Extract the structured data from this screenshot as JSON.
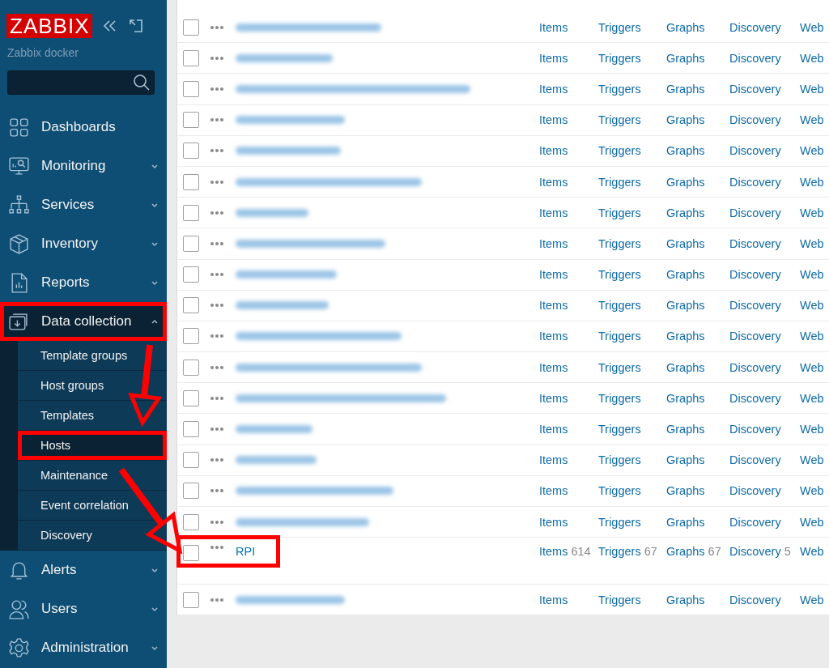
{
  "sidebar": {
    "logo": "ZABBIX",
    "server_name": "Zabbix docker",
    "items": [
      {
        "label": "Dashboards",
        "expandable": false,
        "expanded": false,
        "highlighted": false
      },
      {
        "label": "Monitoring",
        "expandable": true,
        "expanded": false,
        "highlighted": false
      },
      {
        "label": "Services",
        "expandable": true,
        "expanded": false,
        "highlighted": false
      },
      {
        "label": "Inventory",
        "expandable": true,
        "expanded": false,
        "highlighted": false
      },
      {
        "label": "Reports",
        "expandable": true,
        "expanded": false,
        "highlighted": false
      },
      {
        "label": "Data collection",
        "expandable": true,
        "expanded": true,
        "highlighted": true,
        "children": [
          {
            "label": "Template groups",
            "selected": false,
            "highlighted": false
          },
          {
            "label": "Host groups",
            "selected": false,
            "highlighted": false
          },
          {
            "label": "Templates",
            "selected": false,
            "highlighted": false
          },
          {
            "label": "Hosts",
            "selected": true,
            "highlighted": true
          },
          {
            "label": "Maintenance",
            "selected": false,
            "highlighted": false
          },
          {
            "label": "Event correlation",
            "selected": false,
            "highlighted": false
          },
          {
            "label": "Discovery",
            "selected": false,
            "highlighted": false
          }
        ]
      },
      {
        "label": "Alerts",
        "expandable": true,
        "expanded": false,
        "highlighted": false
      },
      {
        "label": "Users",
        "expandable": true,
        "expanded": false,
        "highlighted": false
      },
      {
        "label": "Administration",
        "expandable": true,
        "expanded": false,
        "highlighted": false
      }
    ]
  },
  "hosts": {
    "rows": [
      {
        "kind": "blurred",
        "checked": false,
        "highlighted": false,
        "links": [
          {
            "label": "Items"
          },
          {
            "label": "Triggers"
          },
          {
            "label": "Graphs"
          },
          {
            "label": "Discovery"
          },
          {
            "label": "Web"
          }
        ]
      },
      {
        "kind": "blurred",
        "checked": false,
        "highlighted": false,
        "links": [
          {
            "label": "Items"
          },
          {
            "label": "Triggers"
          },
          {
            "label": "Graphs"
          },
          {
            "label": "Discovery"
          },
          {
            "label": "Web"
          }
        ]
      },
      {
        "kind": "blurred",
        "checked": false,
        "highlighted": false,
        "links": [
          {
            "label": "Items"
          },
          {
            "label": "Triggers"
          },
          {
            "label": "Graphs"
          },
          {
            "label": "Discovery"
          },
          {
            "label": "Web"
          }
        ]
      },
      {
        "kind": "blurred",
        "checked": false,
        "highlighted": false,
        "links": [
          {
            "label": "Items"
          },
          {
            "label": "Triggers"
          },
          {
            "label": "Graphs"
          },
          {
            "label": "Discovery"
          },
          {
            "label": "Web"
          }
        ]
      },
      {
        "kind": "blurred",
        "checked": false,
        "highlighted": false,
        "links": [
          {
            "label": "Items"
          },
          {
            "label": "Triggers"
          },
          {
            "label": "Graphs"
          },
          {
            "label": "Discovery"
          },
          {
            "label": "Web"
          }
        ]
      },
      {
        "kind": "blurred",
        "checked": false,
        "highlighted": false,
        "links": [
          {
            "label": "Items"
          },
          {
            "label": "Triggers"
          },
          {
            "label": "Graphs"
          },
          {
            "label": "Discovery"
          },
          {
            "label": "Web"
          }
        ]
      },
      {
        "kind": "blurred",
        "checked": false,
        "highlighted": false,
        "links": [
          {
            "label": "Items"
          },
          {
            "label": "Triggers"
          },
          {
            "label": "Graphs"
          },
          {
            "label": "Discovery"
          },
          {
            "label": "Web"
          }
        ]
      },
      {
        "kind": "blurred",
        "checked": false,
        "highlighted": false,
        "links": [
          {
            "label": "Items"
          },
          {
            "label": "Triggers"
          },
          {
            "label": "Graphs"
          },
          {
            "label": "Discovery"
          },
          {
            "label": "Web"
          }
        ]
      },
      {
        "kind": "blurred",
        "checked": false,
        "highlighted": false,
        "links": [
          {
            "label": "Items"
          },
          {
            "label": "Triggers"
          },
          {
            "label": "Graphs"
          },
          {
            "label": "Discovery"
          },
          {
            "label": "Web"
          }
        ]
      },
      {
        "kind": "blurred",
        "checked": false,
        "highlighted": false,
        "links": [
          {
            "label": "Items"
          },
          {
            "label": "Triggers"
          },
          {
            "label": "Graphs"
          },
          {
            "label": "Discovery"
          },
          {
            "label": "Web"
          }
        ]
      },
      {
        "kind": "blurred",
        "checked": false,
        "highlighted": false,
        "links": [
          {
            "label": "Items"
          },
          {
            "label": "Triggers"
          },
          {
            "label": "Graphs"
          },
          {
            "label": "Discovery"
          },
          {
            "label": "Web"
          }
        ]
      },
      {
        "kind": "blurred",
        "checked": false,
        "highlighted": false,
        "links": [
          {
            "label": "Items"
          },
          {
            "label": "Triggers"
          },
          {
            "label": "Graphs"
          },
          {
            "label": "Discovery"
          },
          {
            "label": "Web"
          }
        ]
      },
      {
        "kind": "blurred",
        "checked": false,
        "highlighted": false,
        "links": [
          {
            "label": "Items"
          },
          {
            "label": "Triggers"
          },
          {
            "label": "Graphs"
          },
          {
            "label": "Discovery"
          },
          {
            "label": "Web"
          }
        ]
      },
      {
        "kind": "blurred",
        "checked": false,
        "highlighted": false,
        "links": [
          {
            "label": "Items"
          },
          {
            "label": "Triggers"
          },
          {
            "label": "Graphs"
          },
          {
            "label": "Discovery"
          },
          {
            "label": "Web"
          }
        ]
      },
      {
        "kind": "blurred",
        "checked": false,
        "highlighted": false,
        "links": [
          {
            "label": "Items"
          },
          {
            "label": "Triggers"
          },
          {
            "label": "Graphs"
          },
          {
            "label": "Discovery"
          },
          {
            "label": "Web"
          }
        ]
      },
      {
        "kind": "blurred",
        "checked": false,
        "highlighted": false,
        "links": [
          {
            "label": "Items"
          },
          {
            "label": "Triggers"
          },
          {
            "label": "Graphs"
          },
          {
            "label": "Discovery"
          },
          {
            "label": "Web"
          }
        ]
      },
      {
        "kind": "blurred",
        "checked": false,
        "highlighted": false,
        "links": [
          {
            "label": "Items"
          },
          {
            "label": "Triggers"
          },
          {
            "label": "Graphs"
          },
          {
            "label": "Discovery"
          },
          {
            "label": "Web"
          }
        ]
      },
      {
        "kind": "named",
        "name": "RPI",
        "checked": false,
        "highlighted": true,
        "links": [
          {
            "label": "Items",
            "count": "614"
          },
          {
            "label": "Triggers",
            "count": "67"
          },
          {
            "label": "Graphs",
            "count": "67"
          },
          {
            "label": "Discovery",
            "count": "5"
          },
          {
            "label": "Web"
          }
        ]
      },
      {
        "kind": "blurred",
        "checked": false,
        "highlighted": false,
        "links": [
          {
            "label": "Items"
          },
          {
            "label": "Triggers"
          },
          {
            "label": "Graphs"
          },
          {
            "label": "Discovery"
          },
          {
            "label": "Web"
          }
        ]
      }
    ]
  },
  "annotation": {
    "arrows": true
  }
}
